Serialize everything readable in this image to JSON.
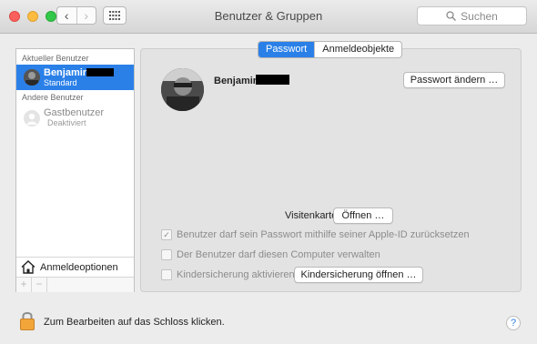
{
  "window": {
    "title": "Benutzer & Gruppen"
  },
  "toolbar": {
    "back_icon": "chevron-left-icon",
    "forward_icon": "chevron-right-icon",
    "grid_icon": "grid-icon",
    "search_placeholder": "Suchen"
  },
  "sidebar": {
    "current_header": "Aktueller Benutzer",
    "current_user": {
      "name": "Benjamin",
      "role": "Standard"
    },
    "others_header": "Andere Benutzer",
    "other_users": [
      {
        "name": "Gastbenutzer",
        "role": "Deaktiviert"
      }
    ],
    "login_options_label": "Anmeldeoptionen",
    "add_label": "+",
    "remove_label": "−"
  },
  "tabs": [
    {
      "label": "Passwort",
      "active": true
    },
    {
      "label": "Anmeldeobjekte",
      "active": false
    }
  ],
  "main": {
    "user_name": "Benjamin",
    "change_password_button": "Passwort ändern …",
    "vcard_label": "Visitenkarte:",
    "vcard_button": "Öffnen …",
    "checkbox_reset": {
      "label": "Benutzer darf sein Passwort mithilfe seiner Apple-ID zurücksetzen",
      "checked": true
    },
    "checkbox_admin": {
      "label": "Der Benutzer darf diesen Computer verwalten",
      "checked": false
    },
    "checkbox_parental": {
      "label": "Kindersicherung aktivieren",
      "checked": false
    },
    "parental_button": "Kindersicherung öffnen …"
  },
  "footer": {
    "lock_text": "Zum Bearbeiten auf das Schloss klicken.",
    "help_label": "?"
  },
  "colors": {
    "accent": "#2b80e8"
  }
}
